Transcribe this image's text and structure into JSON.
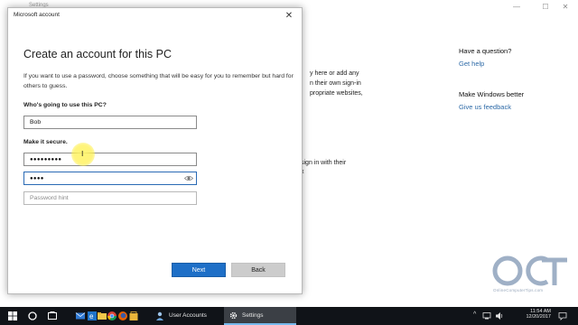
{
  "settings": {
    "title": "Settings",
    "controls": {
      "minimize": "—",
      "maximize": "☐",
      "close": "✕"
    },
    "fragments": [
      "y here or add any",
      "n their own sign-in",
      "propriate websites,",
      "sign in with their",
      "x"
    ],
    "aside": {
      "question_heading": "Have a question?",
      "question_link": "Get help",
      "better_heading": "Make Windows better",
      "better_link": "Give us feedback"
    }
  },
  "dialog": {
    "title": "Microsoft account",
    "close_glyph": "✕",
    "heading": "Create an account for this PC",
    "description": "If you want to use a password, choose something that will be easy for you to remember but hard for others to guess.",
    "user_label": "Who's going to use this PC?",
    "username_value": "Bob",
    "secure_label": "Make it secure.",
    "password_value": "●●●●●●●●●",
    "reenter_value": "●●●●",
    "hint_placeholder": "Password hint",
    "next_label": "Next",
    "back_label": "Back"
  },
  "cursor": {
    "glyph": "I"
  },
  "watermark": {
    "logo_text": "OCT",
    "caption": "OnlineComputerTips.com"
  },
  "taskbar": {
    "apps": [
      {
        "name": "User Accounts",
        "active": false
      },
      {
        "name": "Settings",
        "active": true
      }
    ],
    "time": "11:54 AM",
    "date": "12/20/2017"
  },
  "colors": {
    "accent": "#1e6fc7",
    "link": "#2d6aa7",
    "taskbar": "#101318",
    "cursor_highlight": "#fff06e"
  }
}
